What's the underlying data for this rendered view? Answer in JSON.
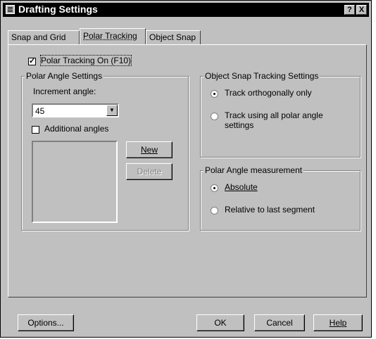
{
  "window": {
    "title": "Drafting Settings",
    "help_label": "?",
    "close_label": "X"
  },
  "tabs": [
    {
      "label": "Snap and Grid"
    },
    {
      "label": "Polar Tracking"
    },
    {
      "label": "Object Snap"
    }
  ],
  "polar_on": {
    "label": "Polar Tracking On (F10)",
    "checked": true
  },
  "angle_settings": {
    "title": "Polar Angle Settings",
    "increment_label": "Increment angle:",
    "increment_value": "45",
    "additional_label": "Additional angles",
    "new_label": "New",
    "delete_label": "Delete"
  },
  "tracking": {
    "title": "Object Snap Tracking Settings",
    "opt1": "Track orthogonally only",
    "opt2_line1": "Track using all polar angle",
    "opt2_line2": "settings"
  },
  "measurement": {
    "title": "Polar Angle measurement",
    "opt1": "Absolute",
    "opt2": "Relative to last segment"
  },
  "footer": {
    "options": "Options...",
    "ok": "OK",
    "cancel": "Cancel",
    "help": "Help"
  }
}
